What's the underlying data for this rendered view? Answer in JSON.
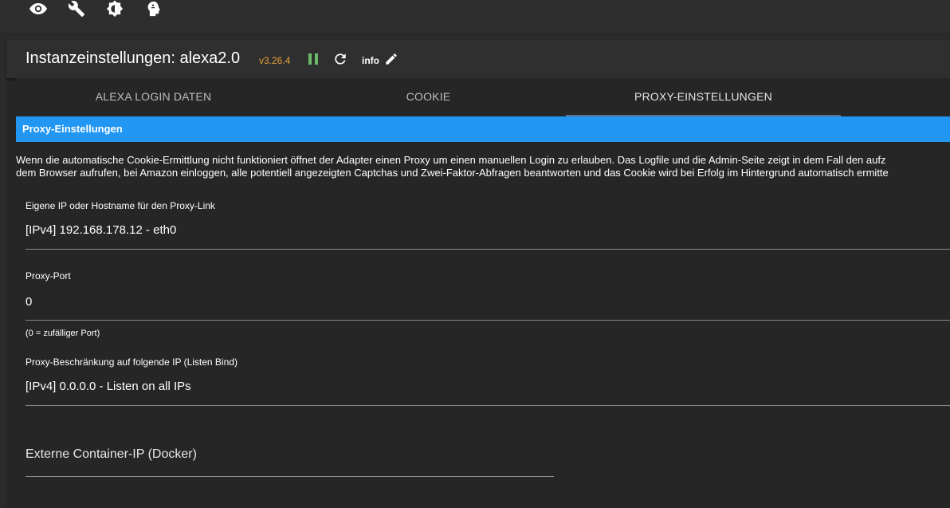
{
  "toolbar": {
    "icons": [
      "eye-icon",
      "wrench-icon",
      "brightness-icon",
      "head-icon"
    ]
  },
  "header": {
    "title": "Instanzeinstellungen: alexa2.0",
    "version": "v3.26.4",
    "info_label": "info",
    "colors": {
      "version": "#e8a33a",
      "pause": "#6dbb6a",
      "accent": "#2196f3"
    }
  },
  "tabs": [
    {
      "label": "ALEXA LOGIN DATEN",
      "active": false
    },
    {
      "label": "COOKIE",
      "active": false
    },
    {
      "label": "PROXY-EINSTELLUNGEN",
      "active": true
    }
  ],
  "section": {
    "title": "Proxy-Einstellungen",
    "description_line1": "Wenn die automatische Cookie-Ermittlung nicht funktioniert öffnet der Adapter einen Proxy um einen manuellen Login zu erlauben. Das Logfile und die Admin-Seite zeigt in dem Fall den aufz",
    "description_line2": "dem Browser aufrufen, bei Amazon einloggen, alle potentiell angezeigten Captchas und Zwei-Faktor-Abfragen beantworten und das Cookie wird bei Erfolg im Hintergrund automatisch ermitte"
  },
  "fields": {
    "own_ip": {
      "label": "Eigene IP oder Hostname für den Proxy-Link",
      "value": "[IPv4] 192.168.178.12 - eth0"
    },
    "proxy_port": {
      "label": "Proxy-Port",
      "value": "0",
      "helper": "(0 = zufälliger Port)"
    },
    "listen_bind": {
      "label": "Proxy-Beschränkung auf folgende IP (Listen Bind)",
      "value": "[IPv4] 0.0.0.0 - Listen on all IPs"
    },
    "container_ip": {
      "label": "Externe Container-IP (Docker)",
      "value": ""
    }
  }
}
